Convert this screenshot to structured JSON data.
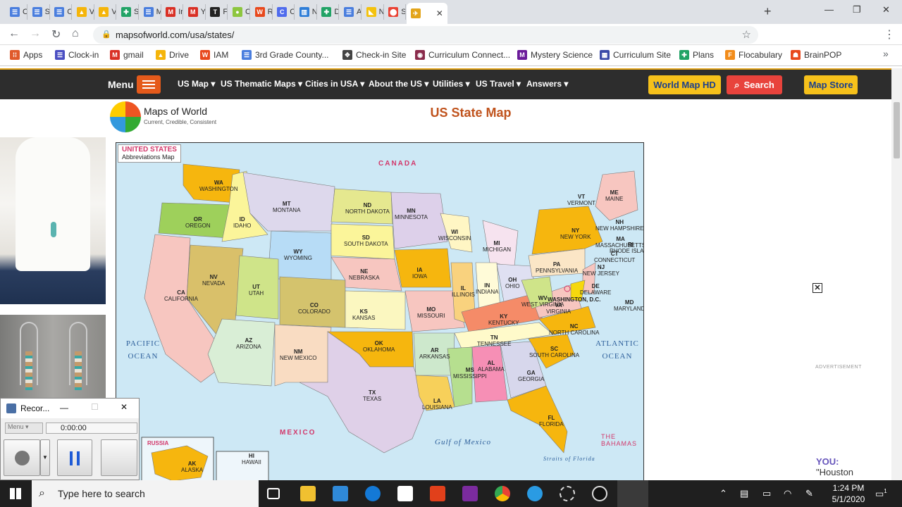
{
  "browser": {
    "tabs": [
      {
        "label": "Cla",
        "color": "#4a7ede",
        "glyph": "☰"
      },
      {
        "label": "Smi",
        "color": "#4a7ede",
        "glyph": "☰"
      },
      {
        "label": "Cop",
        "color": "#4a7ede",
        "glyph": "☰"
      },
      {
        "label": "Virt",
        "color": "#f5b50a",
        "glyph": "▲"
      },
      {
        "label": "Virt",
        "color": "#f5b50a",
        "glyph": "▲"
      },
      {
        "label": "Stu",
        "color": "#21a366",
        "glyph": "✚"
      },
      {
        "label": "Map",
        "color": "#4a7ede",
        "glyph": "☰"
      },
      {
        "label": "Inb",
        "color": "#d93025",
        "glyph": "M"
      },
      {
        "label": "You",
        "color": "#d93025",
        "glyph": "M"
      },
      {
        "label": "Fre",
        "color": "#222222",
        "glyph": "T"
      },
      {
        "label": "Cla",
        "color": "#8dc63f",
        "glyph": "●"
      },
      {
        "label": "Rap",
        "color": "#e8491d",
        "glyph": "W"
      },
      {
        "label": "Cle",
        "color": "#4f6bed",
        "glyph": "C"
      },
      {
        "label": "Nev",
        "color": "#2f7ed8",
        "glyph": "▥"
      },
      {
        "label": "Dic",
        "color": "#21a366",
        "glyph": "✚"
      },
      {
        "label": "Apr",
        "color": "#4a7ede",
        "glyph": "☰"
      },
      {
        "label": "Nat",
        "color": "#f4c20d",
        "glyph": "◣"
      },
      {
        "label": "Sm",
        "color": "#ea4335",
        "glyph": "⬤"
      },
      {
        "label": "",
        "color": "#e3a51b",
        "glyph": "✈"
      }
    ],
    "url": "mapsofworld.com/usa/states/",
    "bookmarks": [
      {
        "label": "Apps",
        "color": "#e05a2b",
        "glyph": "⁞⁞"
      },
      {
        "label": "Clock-in",
        "color": "#4a4ec2",
        "glyph": "☰"
      },
      {
        "label": "gmail",
        "color": "#d93025",
        "glyph": "M"
      },
      {
        "label": "Drive",
        "color": "#f5b50a",
        "glyph": "▲"
      },
      {
        "label": "IAM",
        "color": "#e8491d",
        "glyph": "W"
      },
      {
        "label": "3rd Grade County...",
        "color": "#4a7ede",
        "glyph": "☰"
      },
      {
        "label": "Check-in Site",
        "color": "#444444",
        "glyph": "✥"
      },
      {
        "label": "Curriculum Connect...",
        "color": "#8a2b4b",
        "glyph": "◉"
      },
      {
        "label": "Mystery Science",
        "color": "#6b1b9a",
        "glyph": "M"
      },
      {
        "label": "Curriculum Site",
        "color": "#3b4aa8",
        "glyph": "▦"
      },
      {
        "label": "Plans",
        "color": "#21a366",
        "glyph": "✚"
      },
      {
        "label": "Flocabulary",
        "color": "#f28c1a",
        "glyph": "F"
      },
      {
        "label": "BrainPOP",
        "color": "#e8491d",
        "glyph": "☗"
      }
    ]
  },
  "site": {
    "menu_label": "Menu",
    "nav": [
      "US Map ▾",
      "US Thematic Maps ▾",
      "Cities in USA ▾",
      "About the US ▾",
      "Utilities ▾",
      "US Travel ▾",
      "Answers ▾"
    ],
    "world_map_btn": "World Map HD",
    "search_btn": "Search",
    "map_store_btn": "Map Store",
    "logo_name": "Maps of World",
    "logo_tagline": "Current, Credible, Consistent",
    "page_title": "US State Map",
    "advertisement_label": "ADVERTISEMENT",
    "close_ad": "✕",
    "promo": {
      "you": "YOU:",
      "line": "\"Houston"
    }
  },
  "map": {
    "badge_title": "UNITED STATES",
    "badge_sub": "Abbreviations Map",
    "countries": {
      "canada": "CANADA",
      "mexico": "MEXICO",
      "russia": "RUSSIA",
      "bahamas": "THE BAHAMAS"
    },
    "oceans": {
      "pacific": "PACIFIC OCEAN",
      "atlantic": "ATLANTIC OCEAN",
      "gulf": "Gulf of Mexico",
      "straits": "Straits of Florida"
    },
    "states": [
      {
        "abbr": "WA",
        "name": "WASHINGTON"
      },
      {
        "abbr": "OR",
        "name": "OREGON"
      },
      {
        "abbr": "CA",
        "name": "CALIFORNIA"
      },
      {
        "abbr": "ID",
        "name": "IDAHO"
      },
      {
        "abbr": "NV",
        "name": "NEVADA"
      },
      {
        "abbr": "MT",
        "name": "MONTANA"
      },
      {
        "abbr": "WY",
        "name": "WYOMING"
      },
      {
        "abbr": "UT",
        "name": "UTAH"
      },
      {
        "abbr": "AZ",
        "name": "ARIZONA"
      },
      {
        "abbr": "CO",
        "name": "COLORADO"
      },
      {
        "abbr": "NM",
        "name": "NEW MEXICO"
      },
      {
        "abbr": "ND",
        "name": "NORTH DAKOTA"
      },
      {
        "abbr": "SD",
        "name": "SOUTH DAKOTA"
      },
      {
        "abbr": "NE",
        "name": "NEBRASKA"
      },
      {
        "abbr": "KS",
        "name": "KANSAS"
      },
      {
        "abbr": "OK",
        "name": "OKLAHOMA"
      },
      {
        "abbr": "TX",
        "name": "TEXAS"
      },
      {
        "abbr": "MN",
        "name": "MINNESOTA"
      },
      {
        "abbr": "IA",
        "name": "IOWA"
      },
      {
        "abbr": "MO",
        "name": "MISSOURI"
      },
      {
        "abbr": "AR",
        "name": "ARKANSAS"
      },
      {
        "abbr": "LA",
        "name": "LOUISIANA"
      },
      {
        "abbr": "WI",
        "name": "WISCONSIN"
      },
      {
        "abbr": "IL",
        "name": "ILLINOIS"
      },
      {
        "abbr": "MI",
        "name": "MICHIGAN"
      },
      {
        "abbr": "IN",
        "name": "INDIANA"
      },
      {
        "abbr": "OH",
        "name": "OHIO"
      },
      {
        "abbr": "KY",
        "name": "KENTUCKY"
      },
      {
        "abbr": "TN",
        "name": "TENNESSEE"
      },
      {
        "abbr": "MS",
        "name": "MISSISSIPPI"
      },
      {
        "abbr": "AL",
        "name": "ALABAMA"
      },
      {
        "abbr": "GA",
        "name": "GEORGIA"
      },
      {
        "abbr": "FL",
        "name": "FLORIDA"
      },
      {
        "abbr": "SC",
        "name": "SOUTH CAROLINA"
      },
      {
        "abbr": "NC",
        "name": "NORTH CAROLINA"
      },
      {
        "abbr": "VA",
        "name": "VIRGINIA"
      },
      {
        "abbr": "WV",
        "name": "WEST VIRGINIA"
      },
      {
        "abbr": "PA",
        "name": "PENNSYLVANIA"
      },
      {
        "abbr": "NY",
        "name": "NEW YORK"
      },
      {
        "abbr": "NJ",
        "name": "NEW JERSEY"
      },
      {
        "abbr": "DE",
        "name": "DELAWARE"
      },
      {
        "abbr": "MD",
        "name": "MARYLAND"
      },
      {
        "abbr": "CT",
        "name": "CONNECTICUT"
      },
      {
        "abbr": "RI",
        "name": "RHODE ISLAND"
      },
      {
        "abbr": "MA",
        "name": "MASSACHUSETTS"
      },
      {
        "abbr": "NH",
        "name": "NEW HAMPSHIRE"
      },
      {
        "abbr": "VT",
        "name": "VERMONT"
      },
      {
        "abbr": "ME",
        "name": "MAINE"
      },
      {
        "abbr": "AK",
        "name": "ALASKA"
      },
      {
        "abbr": "HI",
        "name": "HAWAII"
      }
    ],
    "dc_label": "WASHINGTON, D.C."
  },
  "recorder": {
    "title": "Recor...",
    "menu_label": "Menu",
    "time": "0:00:00"
  },
  "taskbar": {
    "search_placeholder": "Type here to search",
    "time": "1:24 PM",
    "date": "5/1/2020",
    "notification_count": "1"
  }
}
